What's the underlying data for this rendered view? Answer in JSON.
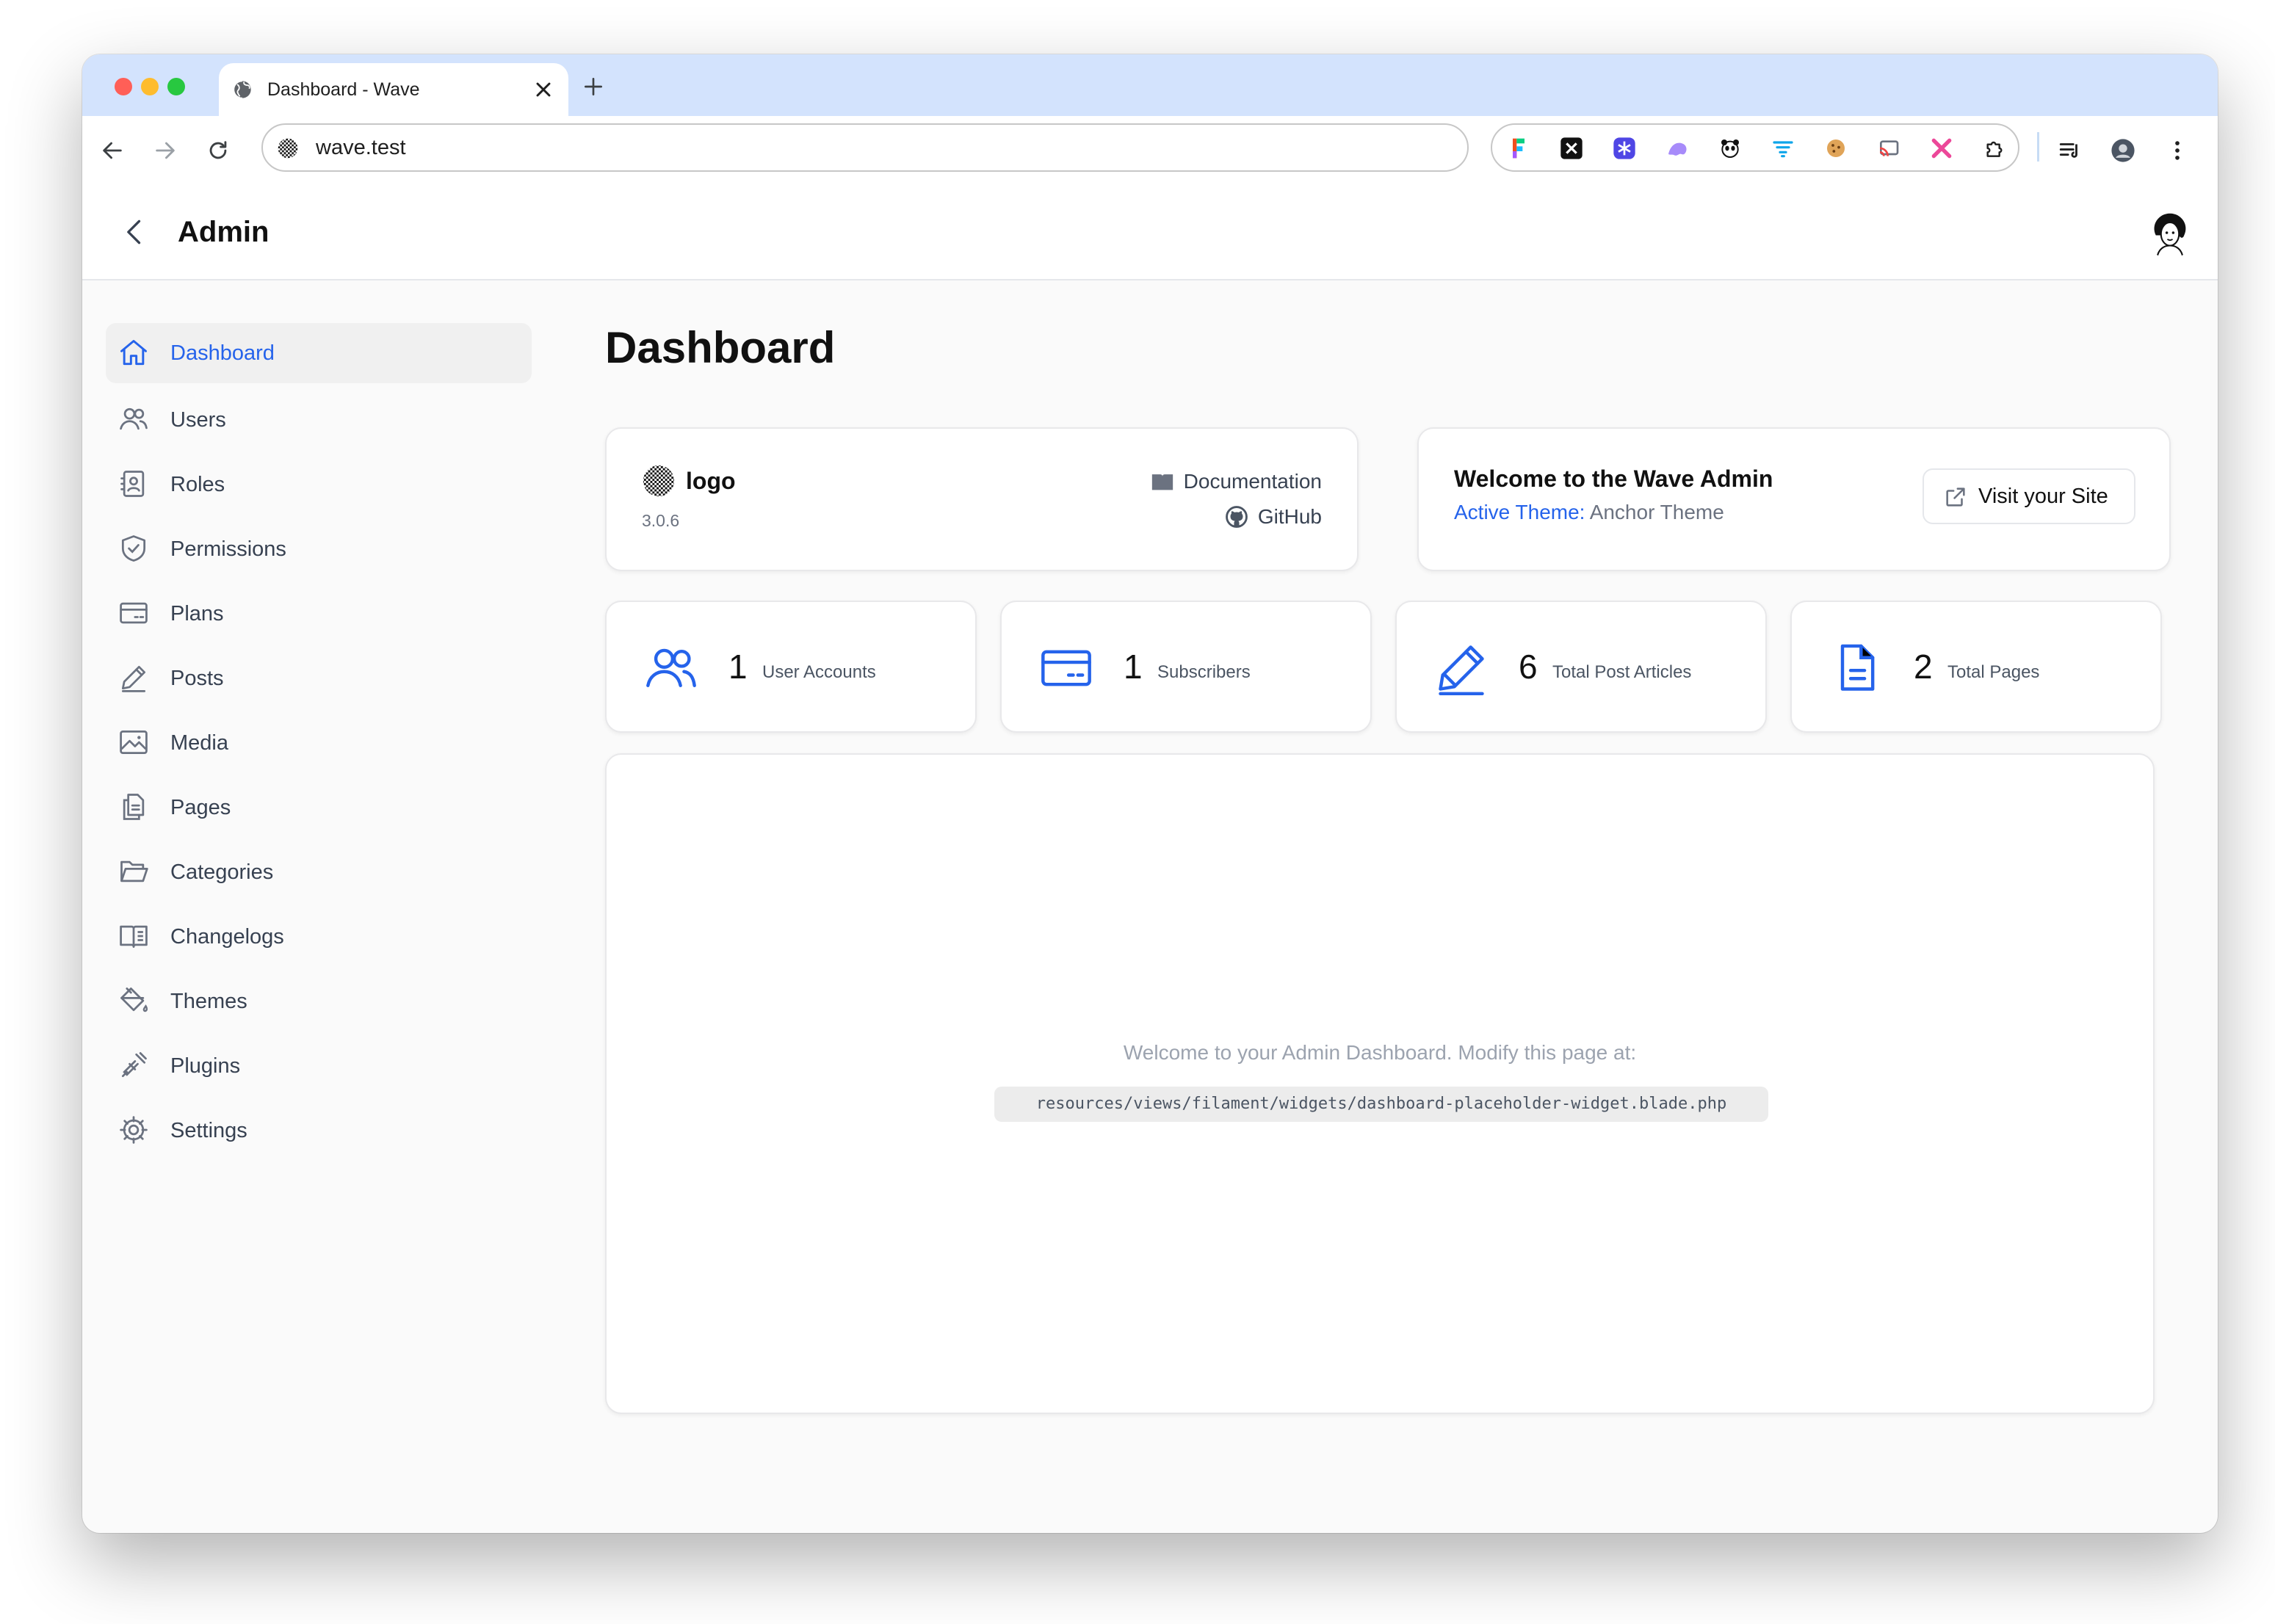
{
  "browser": {
    "tab_title": "Dashboard - Wave",
    "url": "wave.test",
    "extensions": [
      "figma-icon",
      "x-icon",
      "snowflake-icon",
      "ghost-icon",
      "panda-icon",
      "filter-icon",
      "cookie-icon",
      "cast-icon",
      "cross-icon",
      "puzzle-icon"
    ]
  },
  "header": {
    "title": "Admin"
  },
  "sidebar": {
    "items": [
      {
        "label": "Dashboard",
        "icon": "home-icon",
        "active": true
      },
      {
        "label": "Users",
        "icon": "users-icon"
      },
      {
        "label": "Roles",
        "icon": "id-badge-icon"
      },
      {
        "label": "Permissions",
        "icon": "shield-check-icon"
      },
      {
        "label": "Plans",
        "icon": "credit-card-icon"
      },
      {
        "label": "Posts",
        "icon": "pencil-icon"
      },
      {
        "label": "Media",
        "icon": "photo-icon"
      },
      {
        "label": "Pages",
        "icon": "document-duplicate-icon"
      },
      {
        "label": "Categories",
        "icon": "folder-open-icon"
      },
      {
        "label": "Changelogs",
        "icon": "book-open-icon"
      },
      {
        "label": "Themes",
        "icon": "paint-bucket-icon"
      },
      {
        "label": "Plugins",
        "icon": "plug-icon"
      },
      {
        "label": "Settings",
        "icon": "cog-icon"
      }
    ]
  },
  "main": {
    "title": "Dashboard",
    "info_card": {
      "logo_text": "logo",
      "version": "3.0.6",
      "documentation_label": "Documentation",
      "github_label": "GitHub"
    },
    "welcome_card": {
      "title": "Welcome to the Wave Admin",
      "theme_key": "Active Theme:",
      "theme_value": "Anchor Theme",
      "visit_label": "Visit your Site"
    },
    "stats": [
      {
        "value": "1",
        "label": "User Accounts",
        "icon": "users-icon"
      },
      {
        "value": "1",
        "label": "Subscribers",
        "icon": "credit-card-icon"
      },
      {
        "value": "6",
        "label": "Total Post Articles",
        "icon": "pencil-icon"
      },
      {
        "value": "2",
        "label": "Total Pages",
        "icon": "document-text-icon"
      }
    ],
    "placeholder": {
      "text": "Welcome to your Admin Dashboard. Modify this page at:",
      "path": "resources/views/filament/widgets/dashboard-placeholder-widget.blade.php"
    }
  },
  "colors": {
    "accent": "#2563eb",
    "tabstrip": "#d3e3fd"
  }
}
